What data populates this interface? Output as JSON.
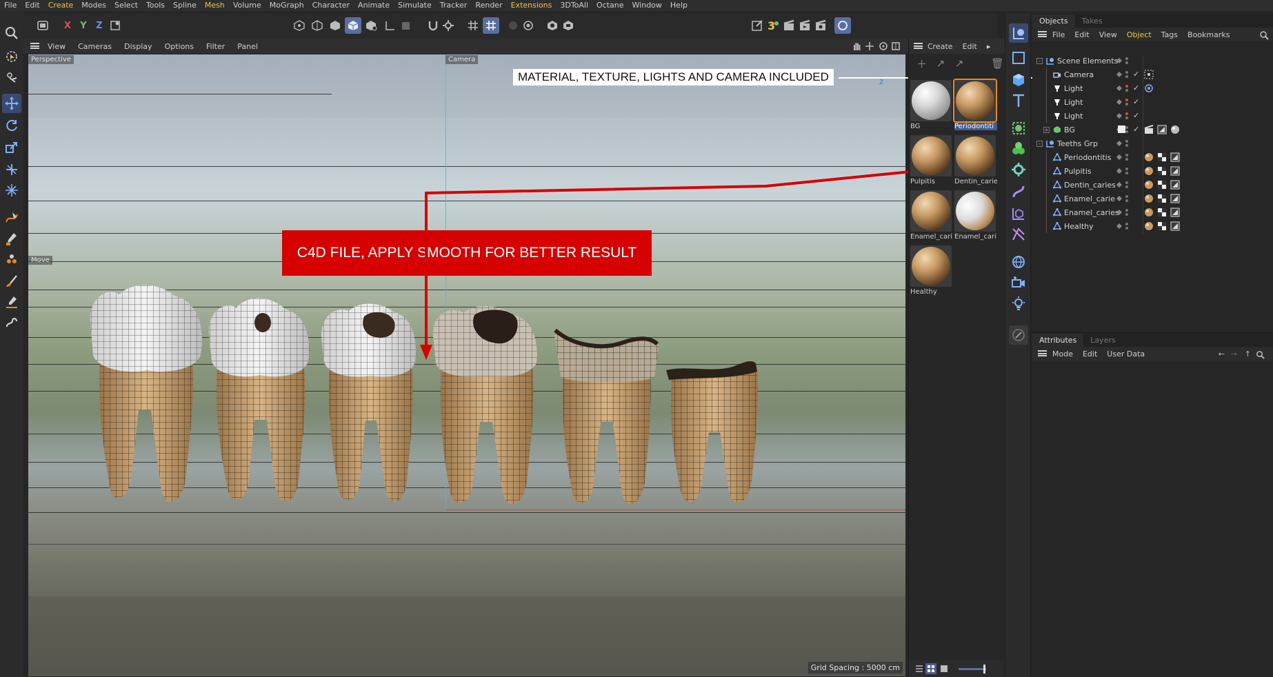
{
  "menubar": {
    "items": [
      {
        "label": "File",
        "hl": false
      },
      {
        "label": "Edit",
        "hl": false
      },
      {
        "label": "Create",
        "hl": true
      },
      {
        "label": "Modes",
        "hl": false
      },
      {
        "label": "Select",
        "hl": false
      },
      {
        "label": "Tools",
        "hl": false
      },
      {
        "label": "Spline",
        "hl": false
      },
      {
        "label": "Mesh",
        "hl": true
      },
      {
        "label": "Volume",
        "hl": false
      },
      {
        "label": "MoGraph",
        "hl": false
      },
      {
        "label": "Character",
        "hl": false
      },
      {
        "label": "Animate",
        "hl": false
      },
      {
        "label": "Simulate",
        "hl": false
      },
      {
        "label": "Tracker",
        "hl": false
      },
      {
        "label": "Render",
        "hl": false
      },
      {
        "label": "Extensions",
        "hl": true
      },
      {
        "label": "3DToAll",
        "hl": false
      },
      {
        "label": "Octane",
        "hl": false
      },
      {
        "label": "Window",
        "hl": false
      },
      {
        "label": "Help",
        "hl": false
      }
    ]
  },
  "toolbar": {
    "x_label": "X",
    "y_label": "Y",
    "z_label": "Z"
  },
  "viewport": {
    "menu": [
      "View",
      "Cameras",
      "Display",
      "Options",
      "Filter",
      "Panel"
    ],
    "view_name": "Perspective",
    "camera_name": "Camera",
    "tool_name": "Move",
    "grid_spacing": "Grid Spacing : 5000 cm",
    "axis_label": "Z"
  },
  "annotations": {
    "material_banner": "MATERIAL, TEXTURE, LIGHTS AND CAMERA INCLUDED",
    "c4d_banner": "C4D FILE, APPLY SMOOTH FOR BETTER RESULT"
  },
  "materials": {
    "menu": [
      "Create",
      "Edit"
    ],
    "items": [
      {
        "name": "BG",
        "style": "white",
        "selected": false
      },
      {
        "name": "Periodontiti",
        "style": "tooth",
        "selected": true
      },
      {
        "name": "Pulpitis",
        "style": "tooth",
        "selected": false
      },
      {
        "name": "Dentin_carie",
        "style": "tooth",
        "selected": false
      },
      {
        "name": "Enamel_cari",
        "style": "tooth",
        "selected": false
      },
      {
        "name": "Enamel_cari",
        "style": "toothwhite",
        "selected": false
      },
      {
        "name": "Healthy",
        "style": "tooth",
        "selected": false
      }
    ]
  },
  "objects": {
    "tabs": [
      "Objects",
      "Takes"
    ],
    "menu": [
      {
        "label": "File",
        "hl": false
      },
      {
        "label": "Edit",
        "hl": false
      },
      {
        "label": "View",
        "hl": false
      },
      {
        "label": "Object",
        "hl": true
      },
      {
        "label": "Tags",
        "hl": false
      },
      {
        "label": "Bookmarks",
        "hl": false
      }
    ],
    "rows": [
      {
        "label": "Scene Elements",
        "icon": "null-icon",
        "indent": 0,
        "twirl": "-",
        "tags": []
      },
      {
        "label": "Camera",
        "icon": "camera-icon",
        "indent": 1,
        "twirl": "",
        "tags": [
          "target"
        ]
      },
      {
        "label": "Light",
        "icon": "light-icon",
        "indent": 1,
        "twirl": "",
        "tags": [
          "target-circle"
        ]
      },
      {
        "label": "Light",
        "icon": "light-icon",
        "indent": 1,
        "twirl": "",
        "tags": []
      },
      {
        "label": "Light",
        "icon": "light-icon",
        "indent": 1,
        "twirl": "",
        "tags": []
      },
      {
        "label": "BG",
        "icon": "bg-icon",
        "indent": 1,
        "twirl": "+",
        "tags": [
          "clapper",
          "phong",
          "sphere"
        ]
      },
      {
        "label": "Teeths Grp",
        "icon": "null-icon",
        "indent": 0,
        "twirl": "-",
        "tags": []
      },
      {
        "label": "Periodontitis",
        "icon": "poly-icon",
        "indent": 1,
        "twirl": "",
        "tags": [
          "mat",
          "check",
          "phong"
        ]
      },
      {
        "label": "Pulpitis",
        "icon": "poly-icon",
        "indent": 1,
        "twirl": "",
        "tags": [
          "mat",
          "check",
          "phong"
        ]
      },
      {
        "label": "Dentin_caries",
        "icon": "poly-icon",
        "indent": 1,
        "twirl": "",
        "tags": [
          "mat",
          "check",
          "phong"
        ]
      },
      {
        "label": "Enamel_carie",
        "icon": "poly-icon",
        "indent": 1,
        "twirl": "",
        "tags": [
          "mat",
          "check",
          "phong"
        ]
      },
      {
        "label": "Enamel_caries",
        "icon": "poly-icon",
        "indent": 1,
        "twirl": "",
        "tags": [
          "mat",
          "check",
          "phong"
        ]
      },
      {
        "label": "Healthy",
        "icon": "poly-icon",
        "indent": 1,
        "twirl": "",
        "tags": [
          "mat",
          "check",
          "phong"
        ]
      }
    ]
  },
  "attributes": {
    "tabs": [
      "Attributes",
      "Layers"
    ],
    "menu": [
      "Mode",
      "Edit",
      "User Data"
    ]
  },
  "colors": {
    "accent": "#5b6e9d",
    "menu_highlight": "#e8c84a",
    "annotation_red": "#d60000",
    "selection_orange": "#e58a1d"
  }
}
